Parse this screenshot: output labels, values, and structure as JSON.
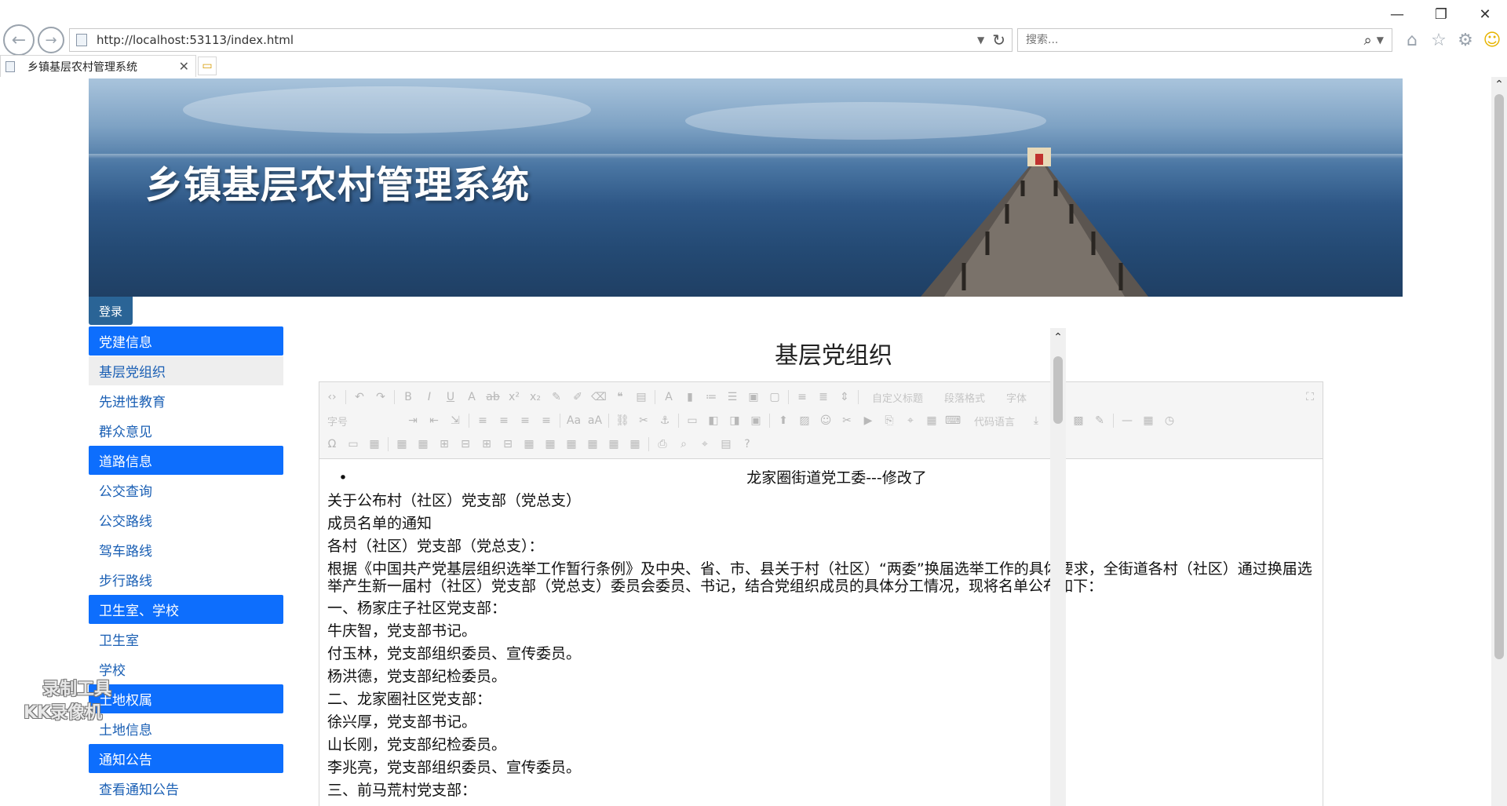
{
  "browser": {
    "url": "http://localhost:53113/index.html",
    "search_placeholder": "搜索...",
    "tab_title": "乡镇基层农村管理系统",
    "window_controls": [
      "—",
      "❐",
      "✕"
    ]
  },
  "banner": {
    "title": "乡镇基层农村管理系统"
  },
  "login_label": "登录",
  "sidebar": {
    "groups": [
      {
        "header": "党建信息",
        "items": [
          "基层党组织",
          "先进性教育",
          "群众意见"
        ]
      },
      {
        "header": "道路信息",
        "items": [
          "公交查询",
          "公交路线",
          "驾车路线",
          "步行路线"
        ]
      },
      {
        "header": "卫生室、学校",
        "items": [
          "卫生室",
          "学校"
        ]
      },
      {
        "header": "土地权属",
        "items": [
          "土地信息"
        ]
      },
      {
        "header": "通知公告",
        "items": [
          "查看通知公告"
        ]
      }
    ],
    "active_item": "基层党组织"
  },
  "page_title": "基层党组织",
  "editor": {
    "toolbar_labels": [
      "自定义标题",
      "段落格式",
      "字体",
      "字号",
      "代码语言"
    ],
    "content": {
      "bullet": "龙家圈街道党工委---修改了",
      "lines": [
        "关于公布村（社区）党支部（党总支）",
        "成员名单的通知",
        "各村（社区）党支部（党总支）：",
        "根据《中国共产党基层组织选举工作暂行条例》及中央、省、市、县关于村（社区）“两委”换届选举工作的具体要求，全街道各村（社区）通过换届选举产生新一届村（社区）党支部（党总支）委员会委员、书记，结合党组织成员的具体分工情况，现将名单公布如下：",
        "一、杨家庄子社区党支部：",
        "牛庆智，党支部书记。",
        "付玉林，党支部组织委员、宣传委员。",
        "杨洪德，党支部纪检委员。",
        "二、龙家圈社区党支部：",
        "徐兴厚，党支部书记。",
        "山长刚，党支部纪检委员。",
        "李兆亮，党支部组织委员、宣传委员。",
        "三、前马荒村党支部："
      ]
    }
  },
  "watermark": [
    "录制工具",
    "KK录像机"
  ]
}
